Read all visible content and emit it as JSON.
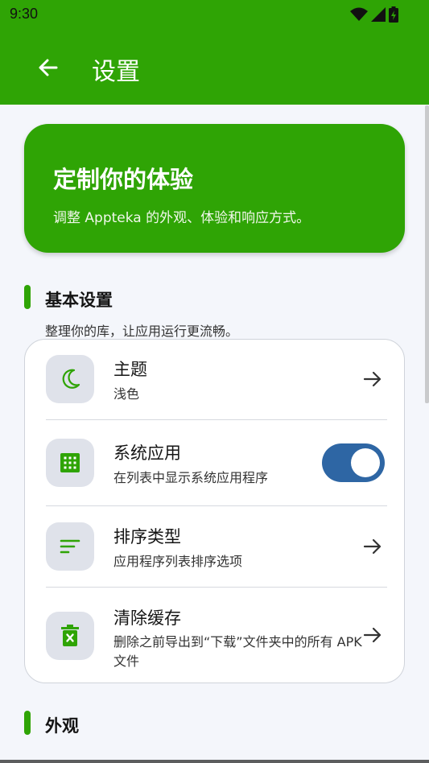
{
  "status": {
    "time": "9:30"
  },
  "appbar": {
    "title": "设置"
  },
  "hero": {
    "title": "定制你的体验",
    "subtitle": "调整 Appteka 的外观、体验和响应方式。"
  },
  "basic": {
    "title": "基本设置",
    "subtitle": "整理你的库，让应用运行更流畅。",
    "items": [
      {
        "title": "主题",
        "subtitle": "浅色",
        "icon": "moon-icon"
      },
      {
        "title": "系统应用",
        "subtitle": "在列表中显示系统应用程序",
        "icon": "grid-icon",
        "toggle": true
      },
      {
        "title": "排序类型",
        "subtitle": "应用程序列表排序选项",
        "icon": "sort-icon"
      },
      {
        "title": "清除缓存",
        "subtitle": "删除之前导出到“下载”文件夹中的所有 APK 文件",
        "icon": "trash-icon"
      }
    ]
  },
  "appearance": {
    "title": "外观"
  },
  "colors": {
    "primary": "#2fa405",
    "toggle": "#2e66a4",
    "icon_bg": "#dfe2ea"
  }
}
